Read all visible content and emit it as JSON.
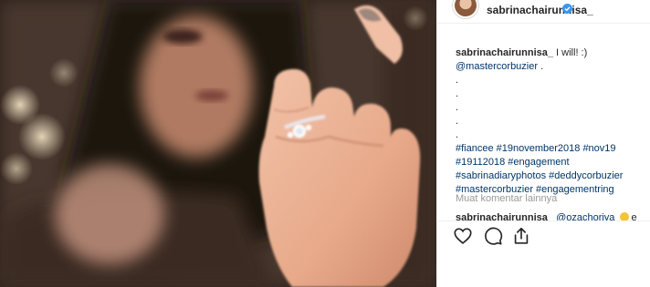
{
  "post": {
    "username": "sabrinachairunnisa_",
    "verified": true,
    "image_icon": "engagement-ring-hand-photo"
  },
  "caption": {
    "username": "sabrinachairunnisa_",
    "text": " I will! :)",
    "mention": "@mastercorbuzier",
    "mention_suffix": " .",
    "dots": [
      ".",
      ".",
      ".",
      ".",
      "."
    ],
    "hashtags_line1": "#fiancee #19november2018 #nov19",
    "hashtags_line2": "#19112018 #engagement",
    "hashtags_line3": "#sabrinadiaryphotos #deddycorbuzier",
    "hashtags_line4": "#mastercorbuzier #engagementring"
  },
  "load_more_label": "Muat komentar lainnya",
  "second_comment": {
    "username": "sabrinachairunnisa_",
    "mention": "@ozachoriya",
    "tail": " e"
  },
  "actions": {
    "like_icon": "heart-icon",
    "comment_icon": "comment-icon",
    "share_icon": "share-icon"
  },
  "colors": {
    "link": "#003569",
    "verified": "#3897f0",
    "muted": "#999999"
  }
}
